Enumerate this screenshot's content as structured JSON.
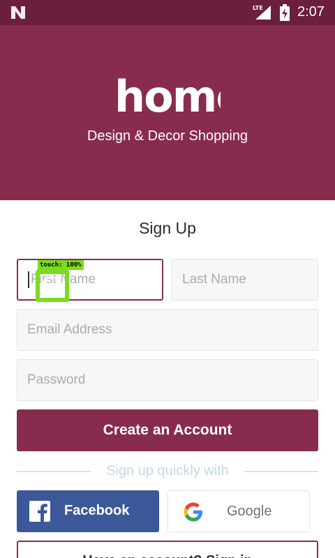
{
  "status_bar": {
    "network": "LTE",
    "time": "2:07"
  },
  "hero": {
    "logo_text": "home",
    "tagline": "Design & Decor Shopping",
    "background_color": "#872c4f"
  },
  "form": {
    "title": "Sign Up",
    "first_name_placeholder": "First Name",
    "last_name_placeholder": "Last Name",
    "email_placeholder": "Email Address",
    "password_placeholder": "Password",
    "create_account_label": "Create an Account",
    "divider_text": "Sign up quickly with"
  },
  "social": {
    "facebook_label": "Facebook",
    "google_label": "Google"
  },
  "login": {
    "label": "Have an account? Sign in"
  },
  "touch_overlay": {
    "label": "touch: 100%"
  },
  "colors": {
    "accent": "#872c4f",
    "status_bar": "#6b1f3c",
    "facebook": "#3b5998",
    "touch_highlight": "#7bdc1e"
  }
}
